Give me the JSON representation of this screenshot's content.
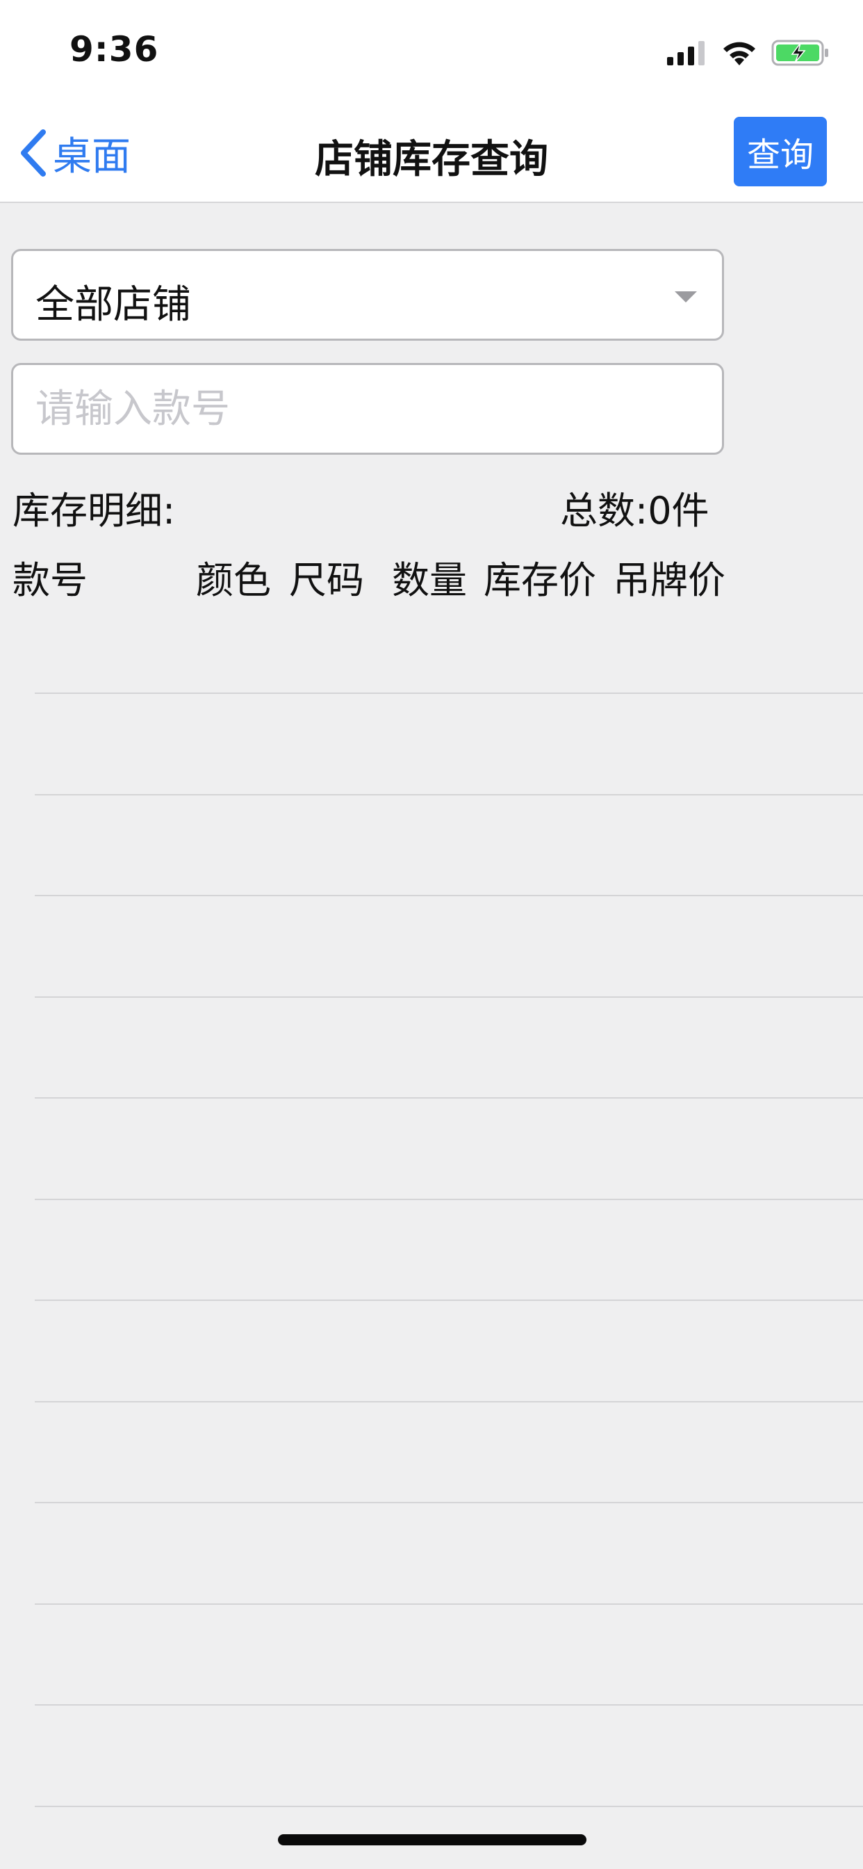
{
  "status_bar": {
    "time": "9:36",
    "icons": [
      "cellular-signal-icon",
      "wifi-icon",
      "battery-charging-icon"
    ]
  },
  "nav": {
    "back_label": "桌面",
    "title": "店铺库存查询",
    "query_button": "查询"
  },
  "store_select": {
    "value": "全部店铺"
  },
  "style_input": {
    "placeholder": "请输入款号",
    "value": ""
  },
  "summary": {
    "detail_label": "库存明细:",
    "total_label": "总数:0件"
  },
  "table": {
    "columns": [
      "款号",
      "颜色",
      "尺码",
      "数量",
      "库存价",
      "吊牌价"
    ],
    "rows": []
  },
  "colors": {
    "accent": "#2f7cf6",
    "background": "#efeff0"
  }
}
